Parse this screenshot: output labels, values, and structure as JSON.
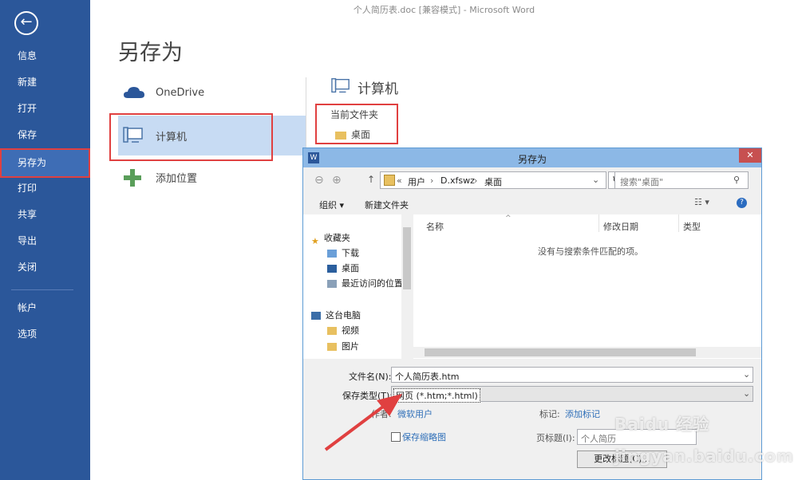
{
  "window_title": "个人简历表.doc [兼容模式] - Microsoft Word",
  "nav": {
    "back_icon": "back-arrow-icon",
    "items": [
      "信息",
      "新建",
      "打开",
      "保存",
      "另存为",
      "打印",
      "共享",
      "导出",
      "关闭"
    ],
    "items2": [
      "帐户",
      "选项"
    ],
    "active": "另存为"
  },
  "main": {
    "title": "另存为",
    "places": [
      {
        "label": "OneDrive",
        "icon": "cloud-icon"
      },
      {
        "label": "计算机",
        "icon": "computer-icon"
      },
      {
        "label": "添加位置",
        "icon": "plus-icon"
      }
    ],
    "right_title": "计算机",
    "current_folder_label": "当前文件夹",
    "current_folder": "桌面"
  },
  "dialog": {
    "title": "另存为",
    "close": "✕",
    "breadcrumb": [
      "用户",
      "D.xfswz",
      "桌面"
    ],
    "breadcrumb_prefix": "«",
    "search_placeholder": "搜索\"桌面\"",
    "toolbar": {
      "organize": "组织 ▾",
      "new_folder": "新建文件夹"
    },
    "columns": {
      "name": "名称",
      "date": "修改日期",
      "type": "类型"
    },
    "empty_msg": "没有与搜索条件匹配的项。",
    "tree": {
      "favorites": "收藏夹",
      "fav_items": [
        "下载",
        "桌面",
        "最近访问的位置"
      ],
      "pc": "这台电脑",
      "pc_items": [
        "视频",
        "图片"
      ]
    },
    "filename_label": "文件名(N):",
    "filename": "个人简历表.htm",
    "filetype_label": "保存类型(T):",
    "filetype": "网页 (*.htm;*.html)",
    "author_label": "作者:",
    "author": "微软用户",
    "tags_label": "标记:",
    "tags_value": "添加标记",
    "thumbnail_label": "保存缩略图",
    "page_title_label": "页标题(I):",
    "page_title_value": "个人简历",
    "change_title_button": "更改标题(C)...",
    "accent": "#2b579a",
    "highlight_red": "#e04040"
  },
  "watermark": "Baidu 经验 jingyan.baidu.com"
}
